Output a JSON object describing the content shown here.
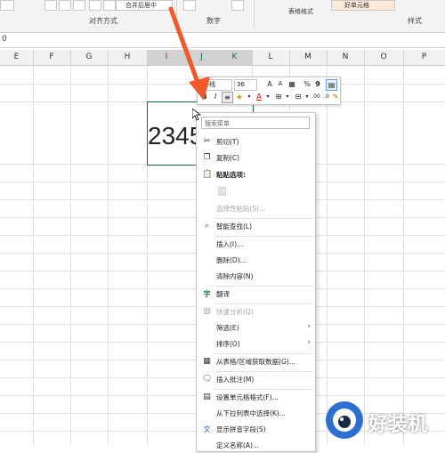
{
  "ribbon": {
    "merge_button": "合并后居中",
    "group_alignment": "对齐方式",
    "group_number": "数字",
    "group_styles": "样式",
    "table_format": "表格格式",
    "cell_style_fragment": "好单元格"
  },
  "formula_bar": {
    "value": "0"
  },
  "columns": [
    "E",
    "F",
    "G",
    "H",
    "I",
    "J",
    "K",
    "L",
    "M",
    "N",
    "O",
    "P"
  ],
  "selected_columns": [
    "I",
    "J",
    "K"
  ],
  "cell": {
    "value": "2345"
  },
  "mini_toolbar": {
    "font_name": "等线",
    "font_size": "36",
    "grow_font": "A",
    "shrink_font": "A",
    "percent": "%",
    "comma": "9",
    "bold": "B",
    "italic": "I",
    "font_color": "A"
  },
  "context_menu": {
    "search_placeholder": "搜索菜单",
    "items": {
      "cut": "剪切(T)",
      "copy": "复制(C)",
      "paste_options": "粘贴选项:",
      "paste_special": "选择性粘贴(S)...",
      "smart_lookup": "智能查找(L)",
      "insert": "插入(I)...",
      "delete": "删除(D)...",
      "clear": "清除内容(N)",
      "translate": "翻译",
      "quick_analysis": "快速分析(Q)",
      "filter": "筛选(E)",
      "sort": "排序(O)",
      "get_data": "从表格/区域获取数据(G)...",
      "insert_comment": "插入批注(M)",
      "format_cells": "设置单元格格式(F)...",
      "pick_list": "从下拉列表中选择(K)...",
      "phonetic": "显示拼音字段(S)",
      "define_name": "定义名称(A)..."
    }
  },
  "watermark": {
    "text": "好装机"
  },
  "colors": {
    "excel_green": "#1e6a3c",
    "arrow_red": "#f0592a"
  }
}
